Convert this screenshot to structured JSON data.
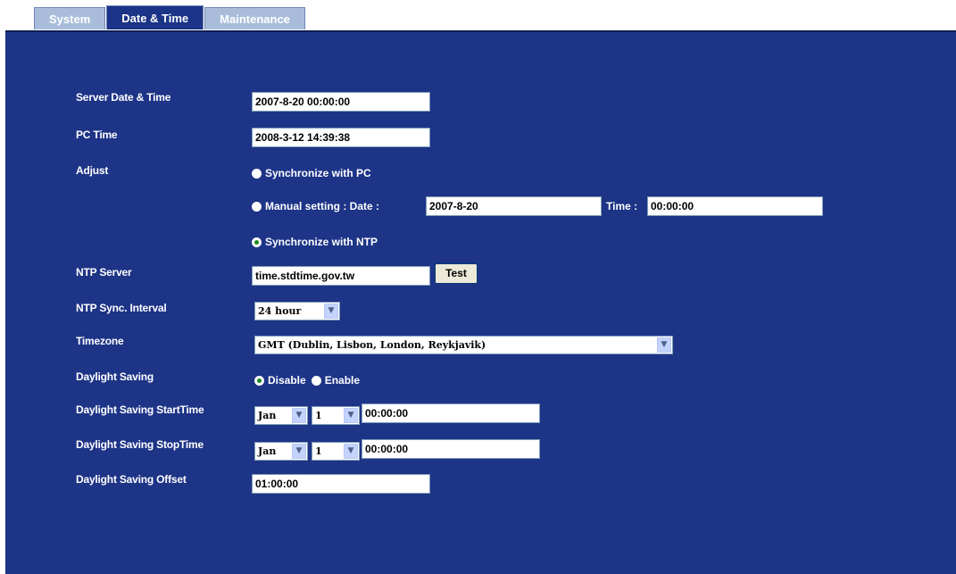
{
  "tabs": [
    {
      "label": "System",
      "active": false
    },
    {
      "label": "Date & Time",
      "active": true
    },
    {
      "label": "Maintenance",
      "active": false
    }
  ],
  "labels": {
    "server_time": "Server Date & Time",
    "pc_time": "PC Time",
    "adjust": "Adjust",
    "ntp_server": "NTP Server",
    "ntp_interval": "NTP Sync. Interval",
    "timezone": "Timezone",
    "dst": "Daylight Saving",
    "dst_start": "Daylight Saving StartTime",
    "dst_stop": "Daylight Saving StopTime",
    "dst_offset": "Daylight Saving Offset"
  },
  "values": {
    "server_time": "2007-8-20 00:00:00",
    "pc_time": "2008-3-12 14:39:38",
    "manual_date": "2007-8-20",
    "manual_time": "00:00:00",
    "ntp_server": "time.stdtime.gov.tw",
    "ntp_interval": "24 hour",
    "timezone": "GMT (Dublin, Lisbon, London, Reykjavik)",
    "start_month": "Jan",
    "start_day": "1",
    "start_time": "00:00:00",
    "stop_month": "Jan",
    "stop_day": "1",
    "stop_time": "00:00:00",
    "offset": "01:00:00"
  },
  "adjust_options": {
    "sync_pc": "Synchronize with PC",
    "manual": "Manual setting : Date :",
    "manual_time_label": "Time :",
    "sync_ntp": "Synchronize with NTP",
    "selected": "sync_ntp"
  },
  "dst_options": {
    "disable": "Disable",
    "enable": "Enable",
    "selected": "disable"
  },
  "buttons": {
    "test": "Test"
  },
  "icons": {
    "dropdown": "chevron-down-icon"
  },
  "colors": {
    "panel": "#1d3487",
    "tab_active": "#1b3487",
    "tab_inactive": "#a9bddb"
  }
}
